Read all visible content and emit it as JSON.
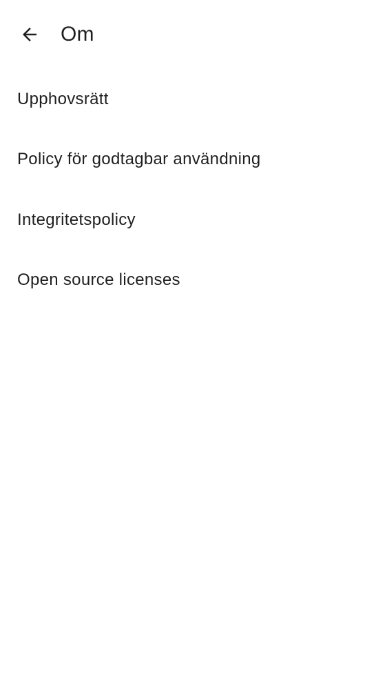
{
  "header": {
    "title": "Om",
    "back_icon": "arrow-back-icon"
  },
  "menu": {
    "items": [
      {
        "label": "Upphovsrätt"
      },
      {
        "label": "Policy för godtagbar användning"
      },
      {
        "label": "Integritetspolicy"
      },
      {
        "label": "Open source licenses"
      }
    ]
  },
  "colors": {
    "background": "#ffffff",
    "text": "#1f1f1f"
  }
}
